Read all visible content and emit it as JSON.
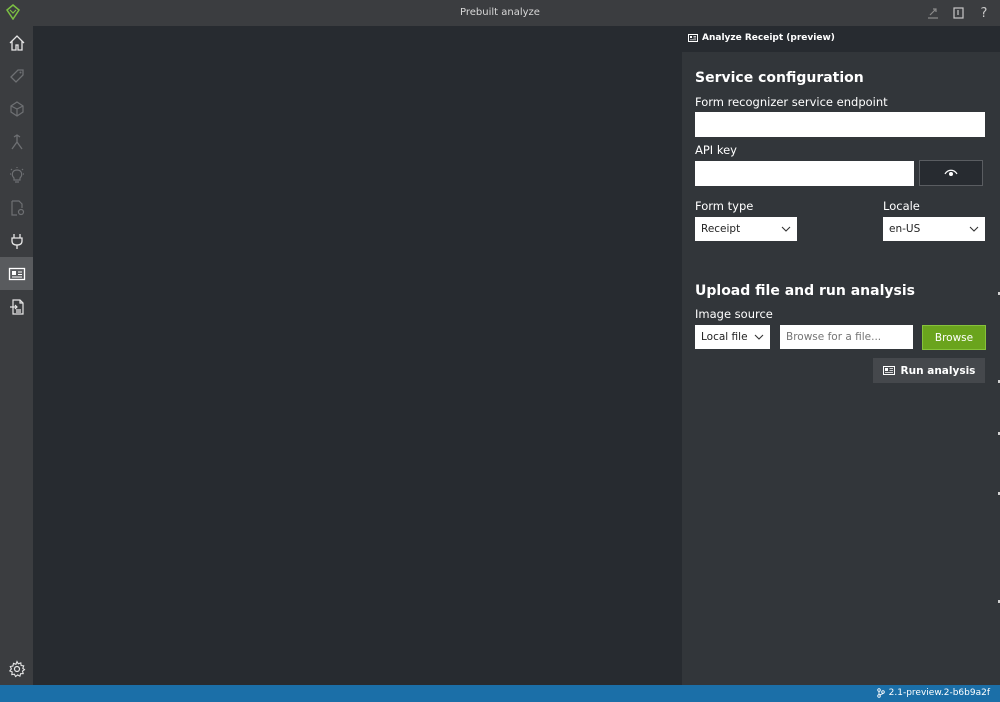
{
  "window": {
    "title": "Prebuilt analyze",
    "logo_icon": "vott-logo-icon",
    "actions": [
      {
        "name": "share-icon"
      },
      {
        "name": "docs-icon"
      },
      {
        "name": "help-icon",
        "label": "?"
      }
    ]
  },
  "nav": {
    "items": [
      {
        "name": "nav-home",
        "icon": "home-icon",
        "active": false
      },
      {
        "name": "nav-tags",
        "icon": "tag-icon",
        "active": false
      },
      {
        "name": "nav-model",
        "icon": "model-icon",
        "active": false
      },
      {
        "name": "nav-train",
        "icon": "merge-icon",
        "active": false
      },
      {
        "name": "nav-analyze",
        "icon": "lightbulb-icon",
        "active": false
      },
      {
        "name": "nav-settings-doc",
        "icon": "doc-settings-icon",
        "active": false
      },
      {
        "name": "nav-connections",
        "icon": "plug-icon",
        "active": false
      },
      {
        "name": "nav-prebuilt",
        "icon": "id-card-icon",
        "active": true
      },
      {
        "name": "nav-layout",
        "icon": "layout-doc-icon",
        "active": false
      }
    ],
    "settings_icon": "gear-icon"
  },
  "panel": {
    "header_title": "Analyze Receipt (preview)",
    "service_config": {
      "title": "Service configuration",
      "endpoint_label": "Form recognizer service endpoint",
      "endpoint_value": "",
      "apikey_label": "API key",
      "apikey_value": "",
      "form_type_label": "Form type",
      "form_type_value": "Receipt",
      "locale_label": "Locale",
      "locale_value": "en-US"
    },
    "upload": {
      "title": "Upload file and run analysis",
      "image_source_label": "Image source",
      "image_source_value": "Local file",
      "file_placeholder": "Browse for a file...",
      "browse_label": "Browse",
      "run_label": "Run analysis"
    }
  },
  "status": {
    "version": "2.1-preview.2-b6b9a2f"
  },
  "colors": {
    "accent_green": "#6aa41d",
    "status_blue": "#1b6fa8",
    "nav_bg": "#3b3d40",
    "panel_bg": "#32363a",
    "canvas_bg": "#272b30"
  }
}
